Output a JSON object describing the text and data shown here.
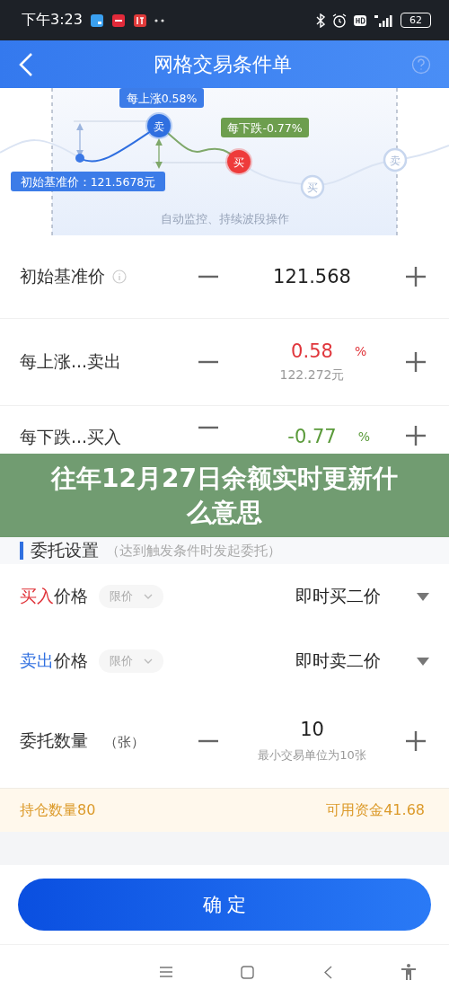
{
  "status_bar": {
    "time": "下午3:23",
    "battery": "62"
  },
  "header": {
    "title": "网格交易条件单"
  },
  "diagram": {
    "rise_label": "每上涨0.58%",
    "fall_label": "每下跌-0.77%",
    "base_label": "初始基准价：121.5678元",
    "caption": "自动监控、持续波段操作",
    "nodes": [
      {
        "label": "卖",
        "kind": "sell",
        "faded": false
      },
      {
        "label": "买",
        "kind": "buy",
        "faded": false
      },
      {
        "label": "买",
        "kind": "buy",
        "faded": true
      },
      {
        "label": "卖",
        "kind": "sell",
        "faded": true
      }
    ]
  },
  "grid_params": [
    {
      "label": "初始基准价",
      "info": true,
      "value": "121.568"
    },
    {
      "label": "每上涨...卖出",
      "info": false,
      "value": "0.58",
      "unit": "%",
      "color": "#e0353b",
      "hint": "122.272元"
    },
    {
      "label": "每下跌...买入",
      "info": false,
      "value": "-0.77",
      "unit": "%",
      "color": "#5a9a3a"
    }
  ],
  "section": {
    "title": "委托设置",
    "note": "（达到触发条件时发起委托）"
  },
  "orders": [
    {
      "color": "#e0353b",
      "action": "买入",
      "label": "价格",
      "price_type": "限价",
      "value": "即时买二价"
    },
    {
      "color": "#2f6fe0",
      "action": "卖出",
      "label": "价格",
      "price_type": "限价",
      "value": "即时卖二价"
    }
  ],
  "quantity": {
    "label": "委托数量",
    "unit": "（张）",
    "value": "10",
    "hint": "最小交易单位为10张"
  },
  "holdings": {
    "position": "持仓数量80",
    "funds": "可用资金41.68"
  },
  "confirm_button": "确 定",
  "banner": {
    "title": "往年12月27日余额实时更新什么意思"
  }
}
